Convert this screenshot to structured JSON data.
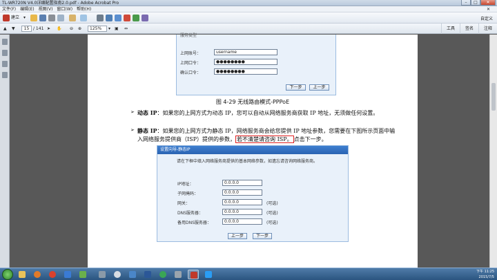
{
  "window": {
    "title": "TL-WR720N V4.0详细配置指南2.0.pdf - Adobe Acrobat Pro",
    "controls": [
      "–",
      "□",
      "✕"
    ]
  },
  "menubar": {
    "items": [
      "文件(F)",
      "编辑(E)",
      "视图(V)",
      "窗口(W)",
      "帮助(H)"
    ]
  },
  "toolbar": {
    "create_label": "建立",
    "customize_label": "自定义"
  },
  "nav": {
    "current_page": "15",
    "total_pages": "/ 141",
    "zoom": "125%"
  },
  "panels": {
    "tools": "工具",
    "sign": "签名",
    "comment": "注释"
  },
  "figure1": {
    "partial_label": "服务类型",
    "fields": [
      {
        "label": "上网账号：",
        "value": "username"
      },
      {
        "label": "上网口令：",
        "value": "●●●●●●●●"
      },
      {
        "label": "确认口令：",
        "value": "●●●●●●●●"
      }
    ],
    "prev": "上一步",
    "next": "下一步",
    "caption": "图 4-29 无线路由模式-PPPoE"
  },
  "body": {
    "dynamic_term": "动态 IP",
    "dynamic_text": "：如果您的上网方式为动态 IP，您可以自动从网络服务商获取 IP 地址，无须做任何设置。",
    "static_term": "静态 IP",
    "static_text": "：如果您的上网方式为静态 IP，网络服务商会给您提供 IP 地址参数，您需要在下图所示页面中输入网络服务提供商（ISP）提供的参数，",
    "static_highlight": "若不清楚请咨询 ISP。",
    "static_tail": "点击下一步。"
  },
  "figure2": {
    "header": "设置向导-静态IP",
    "description": "请在下框中填入网络服务商提供的基本网络参数，如遗忘请咨询网络服务商。",
    "fields": [
      {
        "label": "IP地址：",
        "value": "0.0.0.0",
        "optional": ""
      },
      {
        "label": "子网掩码：",
        "value": "0.0.0.0",
        "optional": ""
      },
      {
        "label": "网关：",
        "value": "0.0.0.0",
        "optional": "(可选)"
      },
      {
        "label": "DNS服务器：",
        "value": "0.0.0.0",
        "optional": "(可选)"
      },
      {
        "label": "备用DNS服务器：",
        "value": "0.0.0.0",
        "optional": "(可选)"
      }
    ],
    "prev": "上一步",
    "next": "下一步"
  },
  "taskbar": {
    "time": "下午 11:25",
    "date": "2015/7/5"
  },
  "colors": {
    "accent": "#2a63b2",
    "figure_bg": "#e9f1fa",
    "highlight_border": "#e02020"
  }
}
